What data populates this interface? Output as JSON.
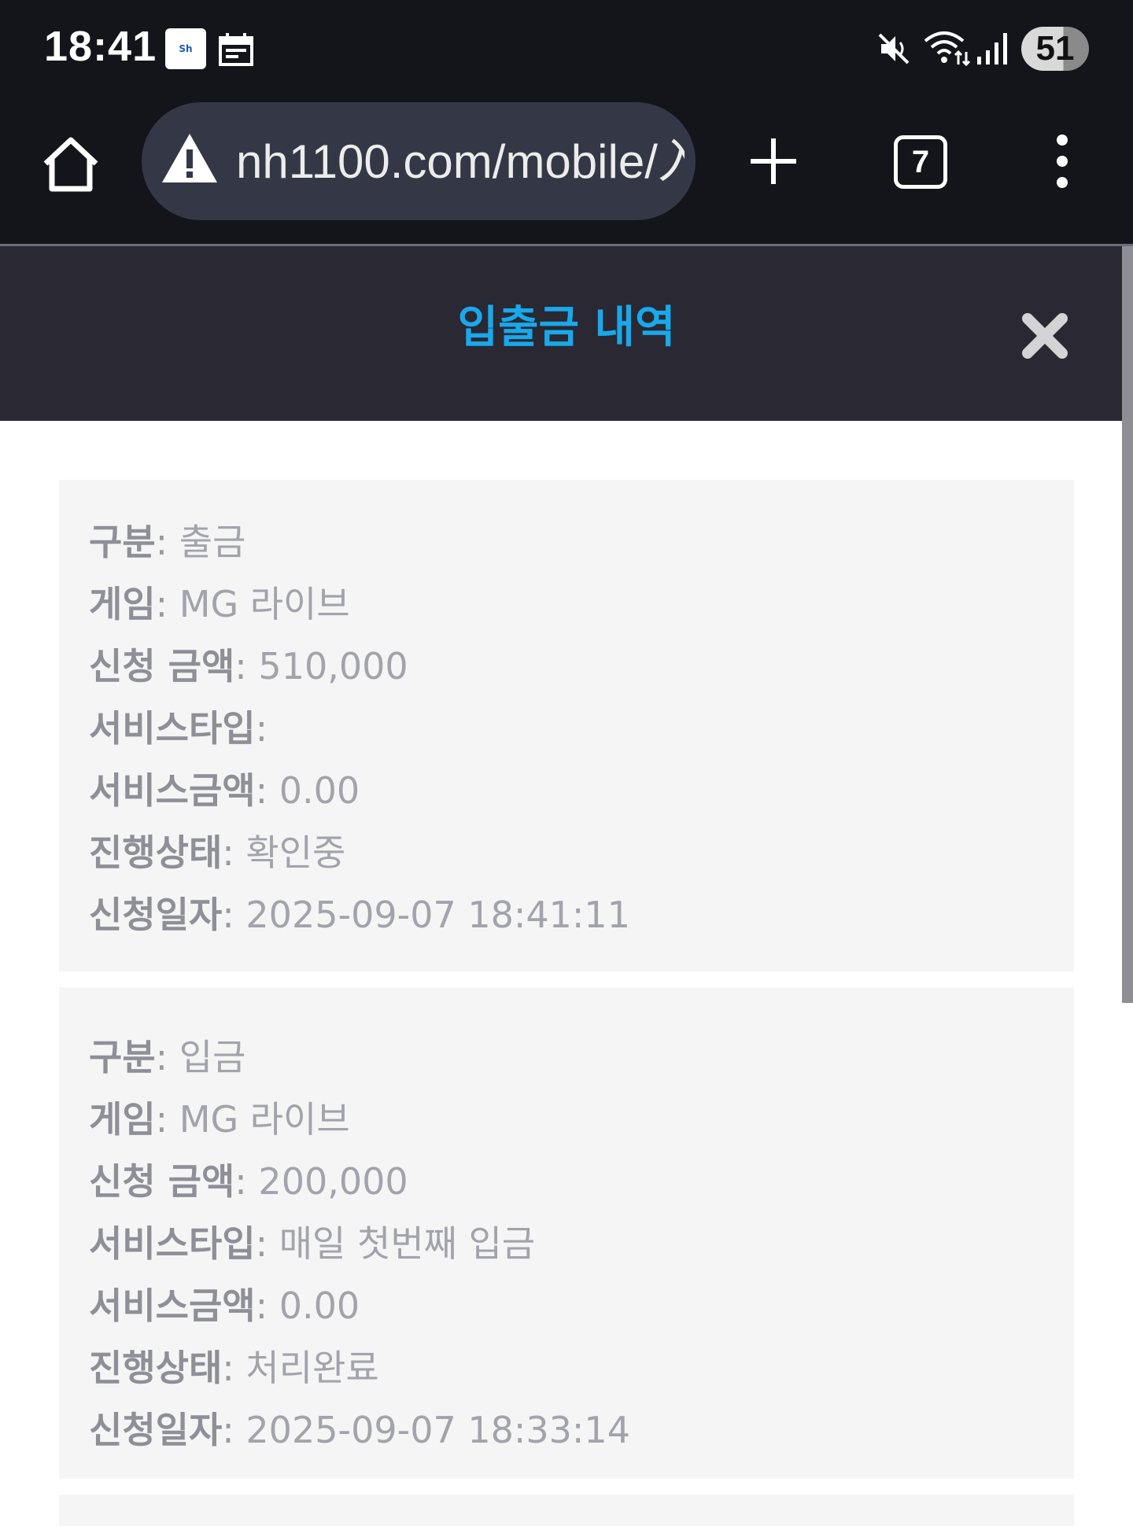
{
  "status_bar": {
    "time": "18:41",
    "notification_icons": [
      "suhyup-bank-icon",
      "calendar-icon"
    ],
    "system_icons": [
      "mute-icon",
      "wifi-icon",
      "signal-icon"
    ],
    "battery": "51"
  },
  "browser": {
    "url": "nh1100.com/mobile/入",
    "security_icon": "warning-icon",
    "tab_count": "7"
  },
  "modal": {
    "title": "입출금 내역",
    "close_icon": "close-icon"
  },
  "records": [
    {
      "type_label": "구분",
      "type_value": "출금",
      "game_label": "게임",
      "game_value": "MG 라이브",
      "amount_label": "신청 금액",
      "amount_value": "510,000",
      "service_type_label": "서비스타입",
      "service_type_value": "",
      "service_amount_label": "서비스금액",
      "service_amount_value": "0.00",
      "status_label": "진행상태",
      "status_value": "확인중",
      "date_label": "신청일자",
      "date_value": "2025-09-07 18:41:11"
    },
    {
      "type_label": "구분",
      "type_value": "입금",
      "game_label": "게임",
      "game_value": "MG 라이브",
      "amount_label": "신청 금액",
      "amount_value": "200,000",
      "service_type_label": "서비스타입",
      "service_type_value": "매일 첫번째 입금",
      "service_amount_label": "서비스금액",
      "service_amount_value": "0.00",
      "status_label": "진행상태",
      "status_value": "처리완료",
      "date_label": "신청일자",
      "date_value": "2025-09-07 18:33:14"
    }
  ],
  "colors": {
    "title_accent": "#19a8ea",
    "header_bg": "#292833",
    "card_bg": "#f5f5f5",
    "label_text": "#8e8f97"
  }
}
